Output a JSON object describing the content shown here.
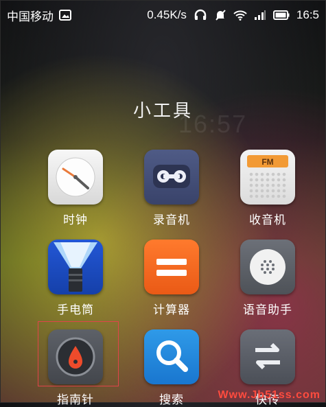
{
  "status_bar": {
    "carrier": "中国移动",
    "speed": "0.45K/s",
    "time": "16:5",
    "icons": [
      "image-icon",
      "headphones-icon",
      "mute-icon",
      "wifi-icon",
      "signal-icon",
      "battery-icon"
    ]
  },
  "background": {
    "ghost_time": "16:57"
  },
  "folder": {
    "title": "小工具"
  },
  "apps": [
    {
      "label": "时钟",
      "icon": "clock-icon"
    },
    {
      "label": "录音机",
      "icon": "recorder-icon"
    },
    {
      "label": "收音机",
      "icon": "radio-icon",
      "badge": "FM"
    },
    {
      "label": "手电筒",
      "icon": "flashlight-icon"
    },
    {
      "label": "计算器",
      "icon": "calculator-icon"
    },
    {
      "label": "语音助手",
      "icon": "voice-assistant-icon"
    },
    {
      "label": "指南针",
      "icon": "compass-icon"
    },
    {
      "label": "搜索",
      "icon": "search-icon"
    },
    {
      "label": "快传",
      "icon": "transfer-icon"
    }
  ],
  "watermark": "Www.Jb51ss.com"
}
